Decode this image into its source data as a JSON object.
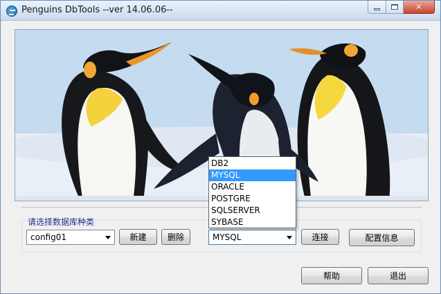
{
  "window": {
    "title": "Penguins DbTools --ver 14.06.06--",
    "close_symbol": "✕"
  },
  "banner": {
    "icon": "penguins-photo"
  },
  "group": {
    "label": "请选择数据库种类"
  },
  "config": {
    "selected": "config01"
  },
  "buttons": {
    "new": "新建",
    "delete": "删除",
    "connect": "连接",
    "config_info": "配置信息",
    "help": "帮助",
    "quit": "退出"
  },
  "dbtype": {
    "selected": "MYSQL",
    "options": [
      "DB2",
      "MYSQL",
      "ORACLE",
      "POSTGRE",
      "SQLSERVER",
      "SYBASE"
    ],
    "highlighted": "MYSQL"
  },
  "colors": {
    "selection": "#3399ff",
    "group_label": "#1e3287",
    "close_button": "#c6442d"
  }
}
